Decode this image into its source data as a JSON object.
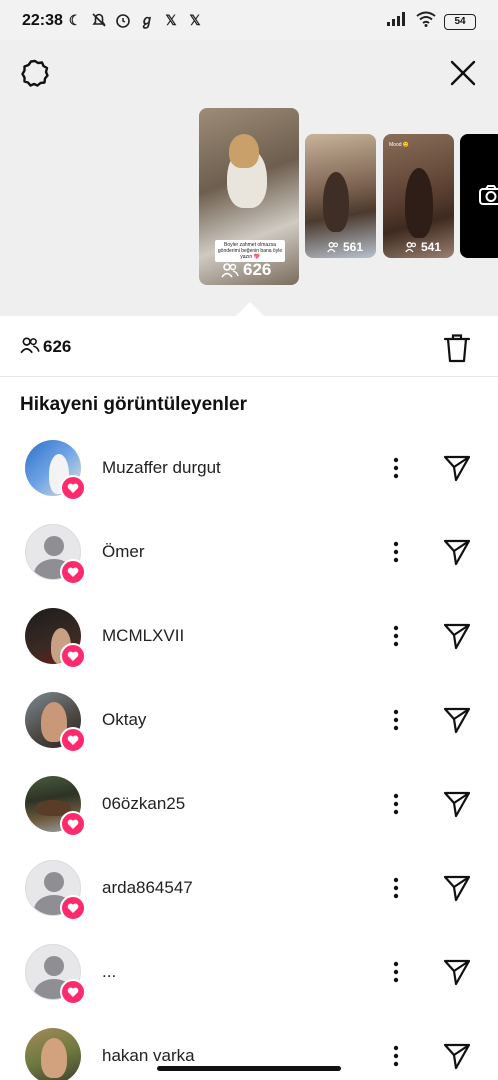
{
  "status_bar": {
    "time": "22:38",
    "battery": "54"
  },
  "story": {
    "main_caption": "Boyler zahmet olmazsa gönderimi beğenin bana öyle yazın 💖",
    "main_count": "626",
    "thumb2_count": "561",
    "thumb3_count": "541",
    "thumb3_tag": "Mood 😊"
  },
  "viewers_total": "626",
  "section_title": "Hikayeni görüntüleyenler",
  "viewers": [
    {
      "name": "Muzaffer durgut"
    },
    {
      "name": "Ömer"
    },
    {
      "name": "MCMLXVII"
    },
    {
      "name": "Oktay"
    },
    {
      "name": "06özkan25"
    },
    {
      "name": "arda864547"
    },
    {
      "name": "..."
    },
    {
      "name": "hakan varka"
    }
  ],
  "colors": {
    "like_heart": "#ff2a6e",
    "header_bg": "#efefef"
  }
}
